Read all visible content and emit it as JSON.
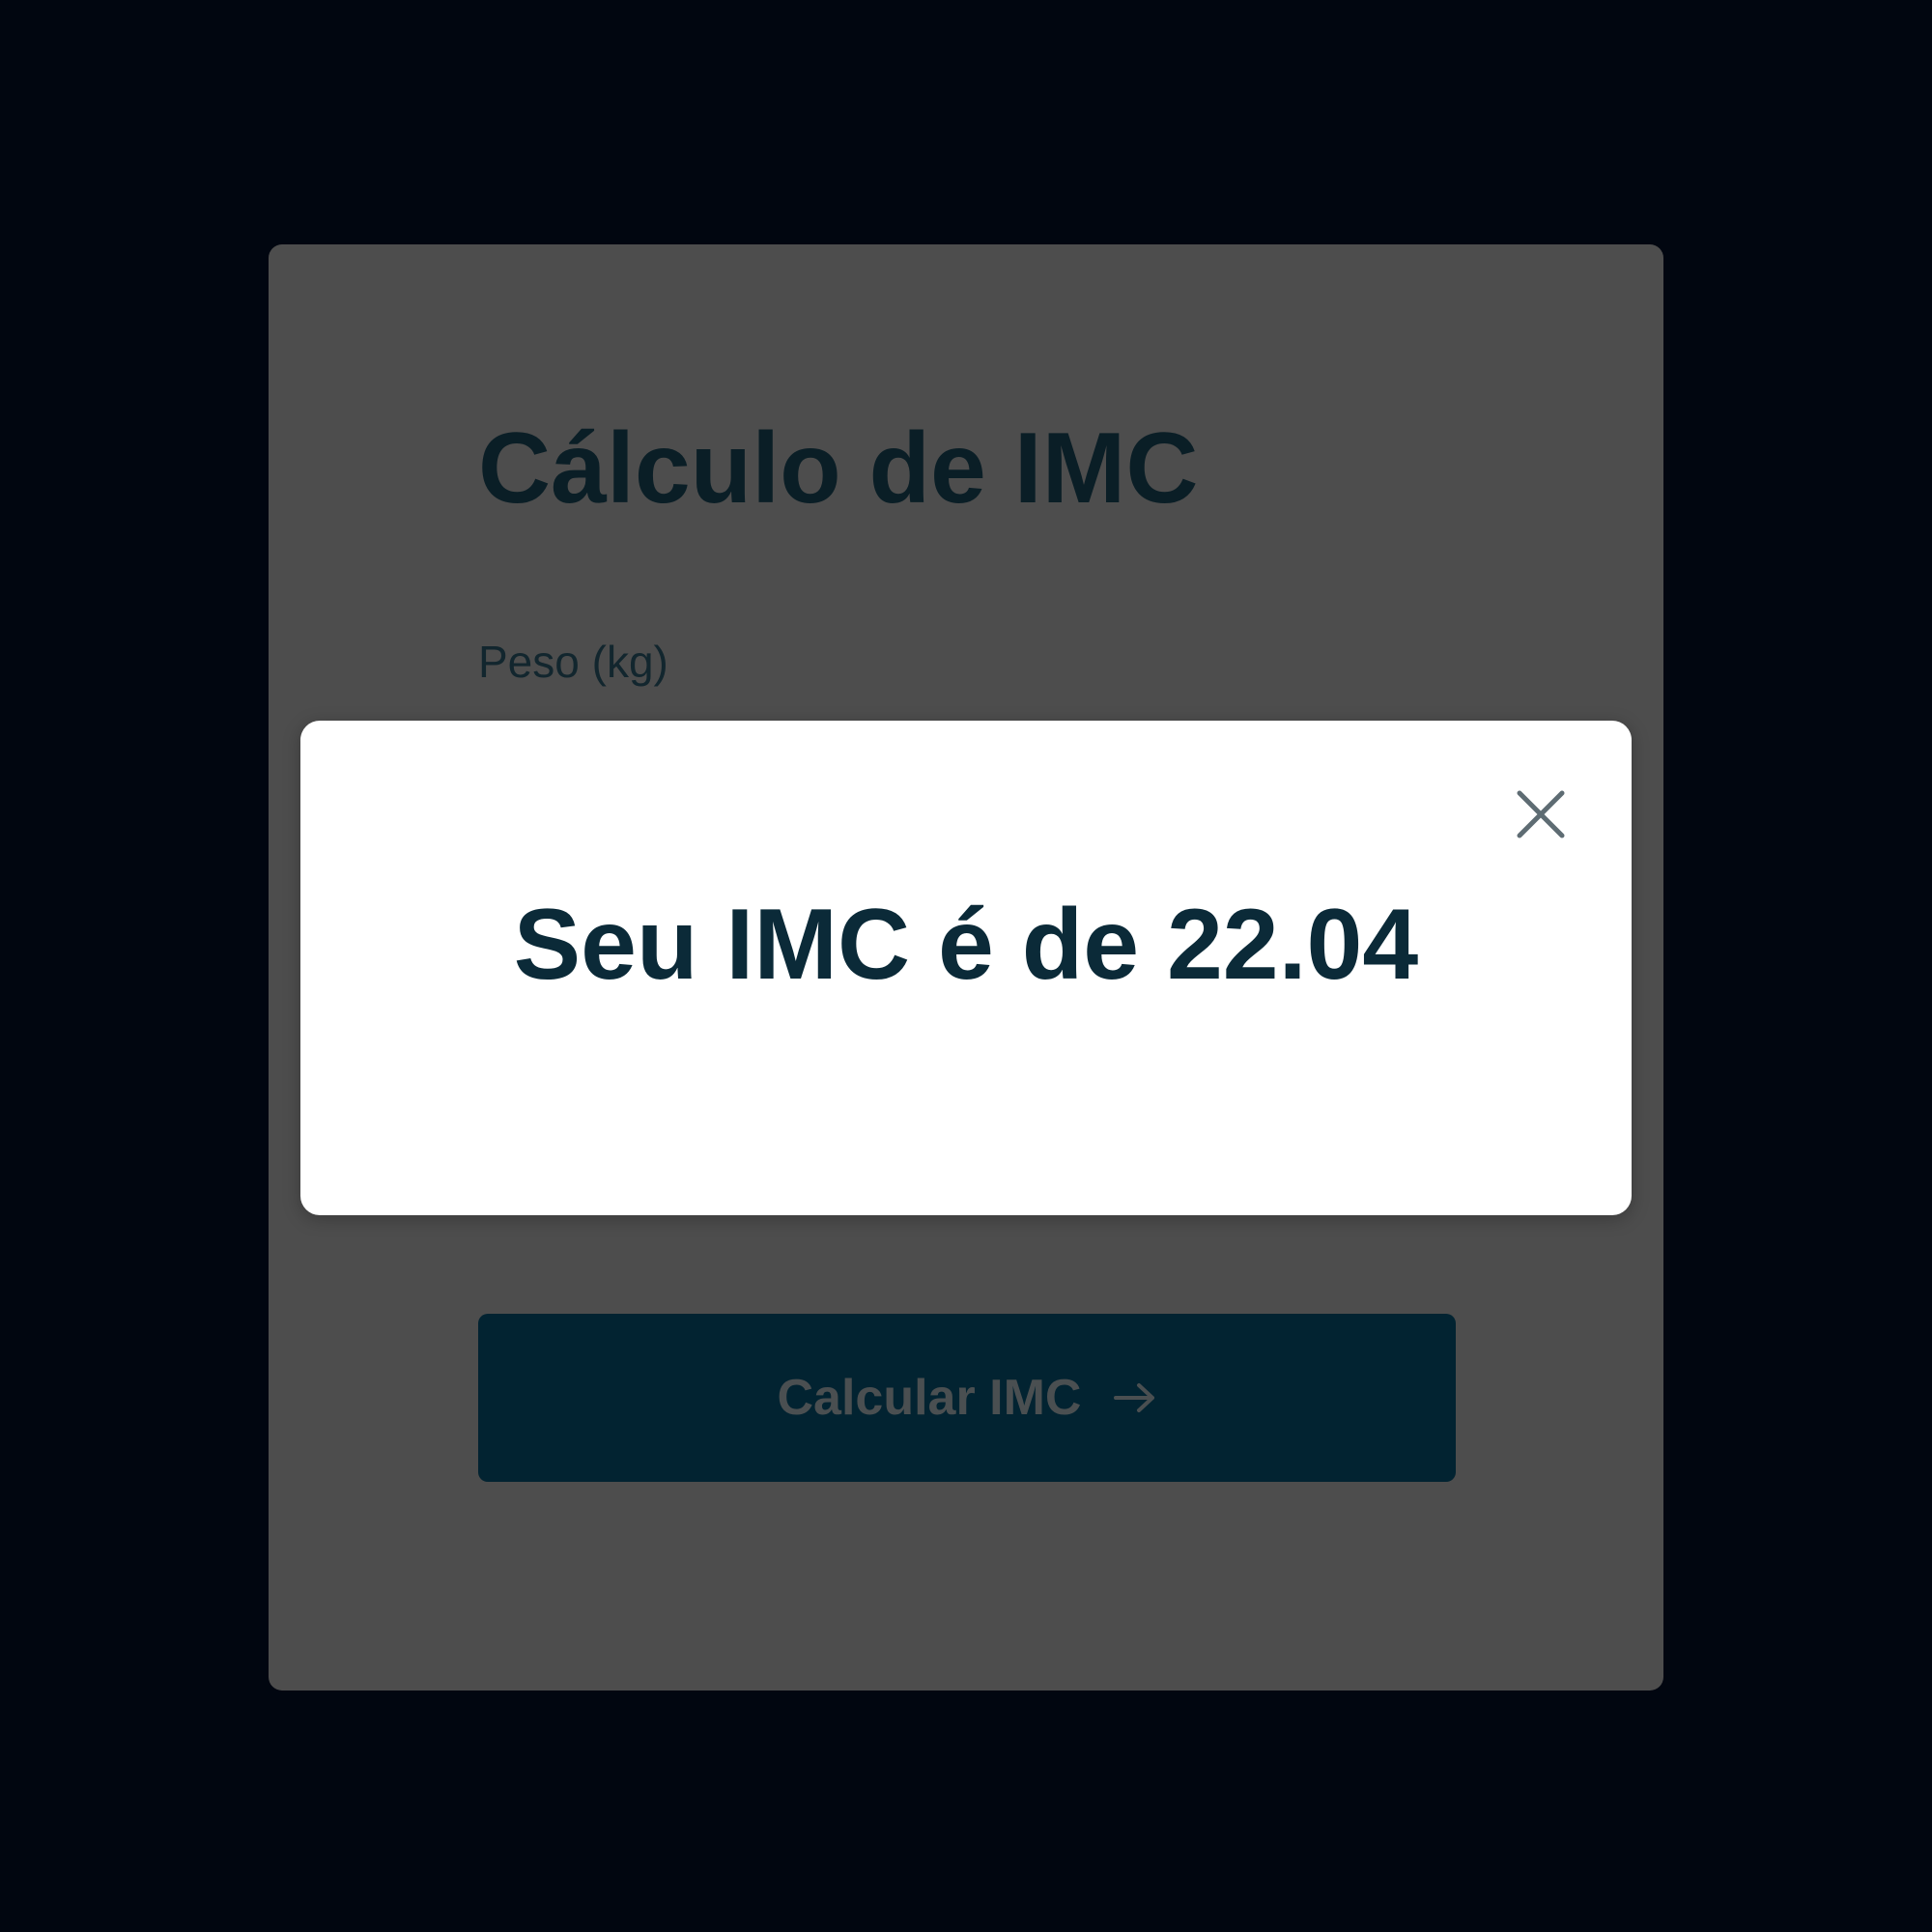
{
  "form": {
    "title": "Cálculo de IMC",
    "weight_label": "Peso (kg)",
    "submit_label": "Calcular IMC",
    "submit_icon": "arrow-right-icon"
  },
  "modal": {
    "result_text": "Seu IMC é de 22.04",
    "close_icon": "close-icon"
  },
  "colors": {
    "background": "#010610",
    "card": "#4d4d4d",
    "button": "#022331",
    "modal": "#ffffff",
    "result_text": "#0b2a38"
  }
}
